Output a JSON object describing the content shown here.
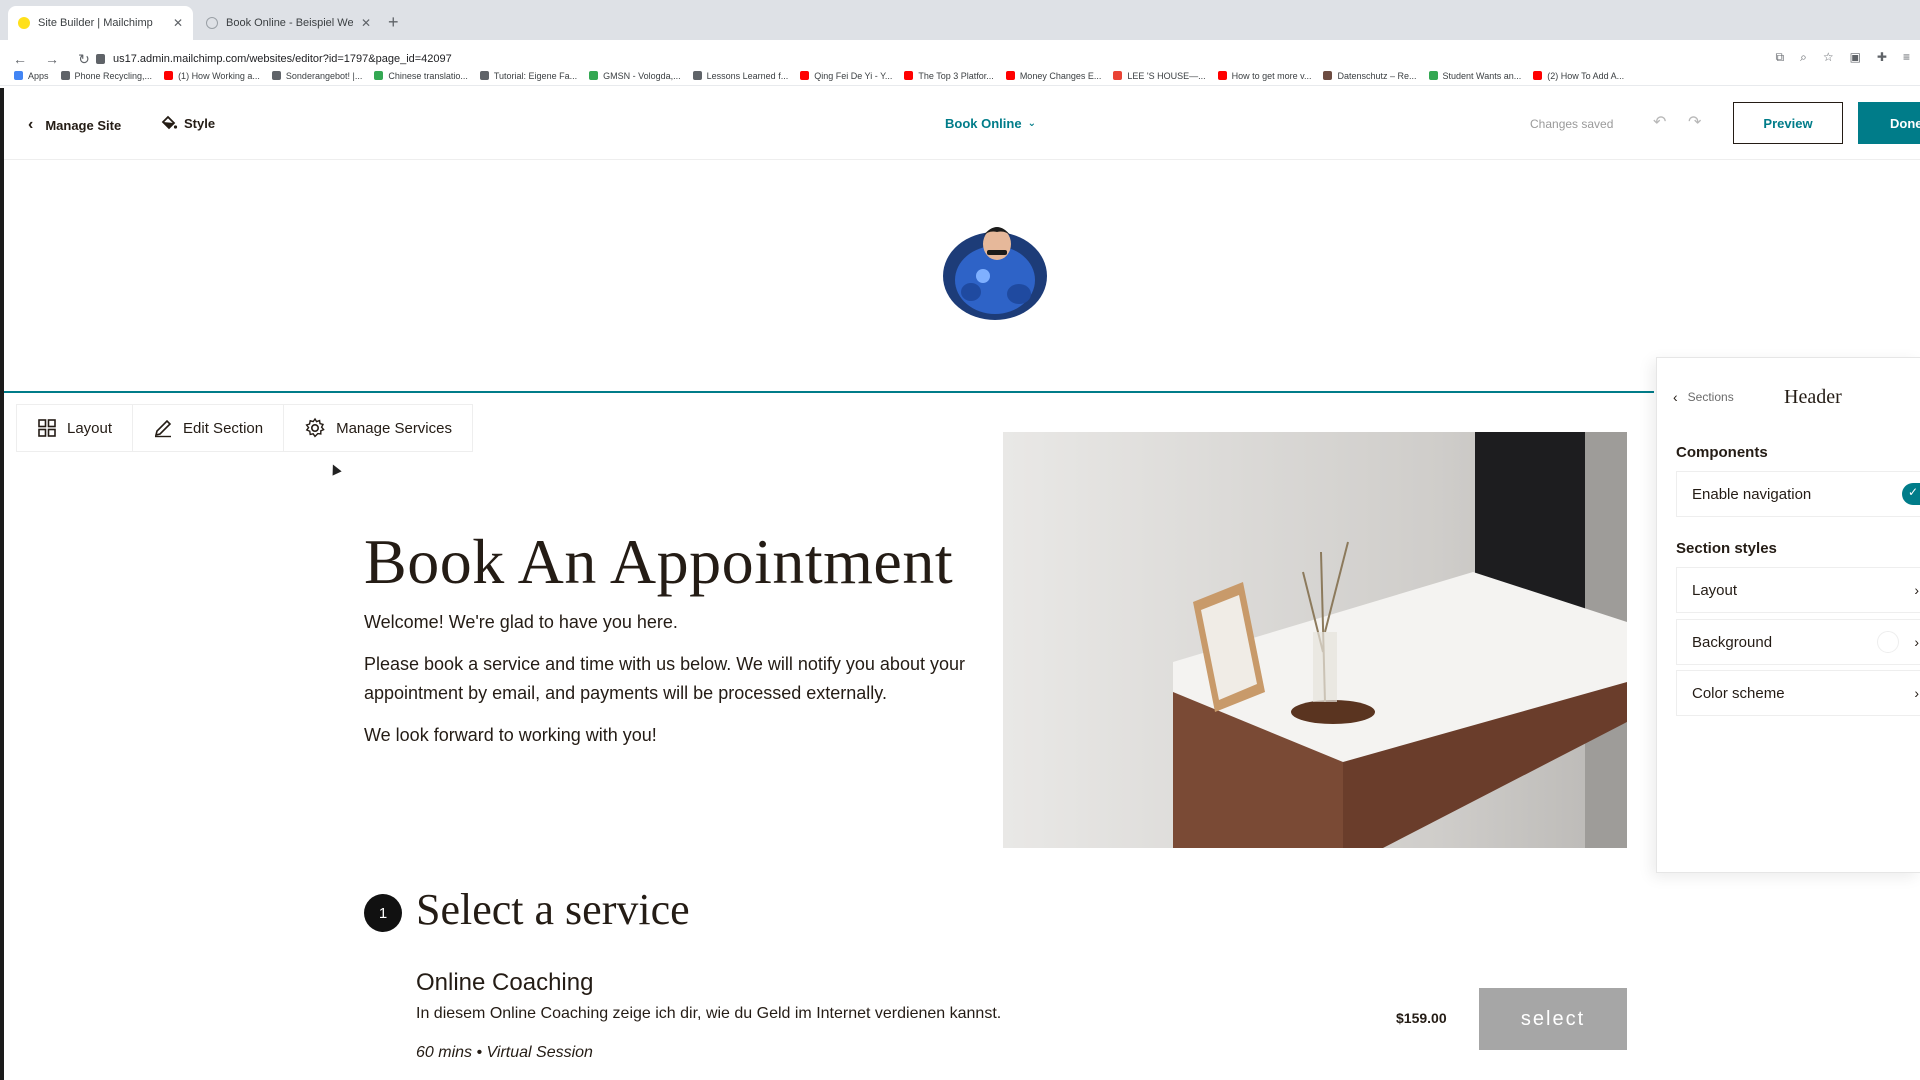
{
  "browser": {
    "tabs": [
      {
        "title": "Site Builder | Mailchimp",
        "favicon_color": "#ffe01b"
      },
      {
        "title": "Book Online - Beispiel Websei",
        "favicon_color": "#9aa0a6"
      }
    ],
    "url": "us17.admin.mailchimp.com/websites/editor?id=1797&page_id=42097",
    "bookmarks": [
      {
        "label": "Apps",
        "color": "#4285f4"
      },
      {
        "label": "Phone Recycling,...",
        "color": "#5f6368"
      },
      {
        "label": "(1) How Working a...",
        "color": "#ff0000"
      },
      {
        "label": "Sonderangebot! |...",
        "color": "#5f6368"
      },
      {
        "label": "Chinese translatio...",
        "color": "#34a853"
      },
      {
        "label": "Tutorial: Eigene Fa...",
        "color": "#5f6368"
      },
      {
        "label": "GMSN - Vologda,...",
        "color": "#34a853"
      },
      {
        "label": "Lessons Learned f...",
        "color": "#5f6368"
      },
      {
        "label": "Qing Fei De Yi - Y...",
        "color": "#ff0000"
      },
      {
        "label": "The Top 3 Platfor...",
        "color": "#ff0000"
      },
      {
        "label": "Money Changes E...",
        "color": "#ff0000"
      },
      {
        "label": "LEE 'S HOUSE—...",
        "color": "#ea4335"
      },
      {
        "label": "How to get more v...",
        "color": "#ff0000"
      },
      {
        "label": "Datenschutz – Re...",
        "color": "#6d4c41"
      },
      {
        "label": "Student Wants an...",
        "color": "#34a853"
      },
      {
        "label": "(2) How To Add A...",
        "color": "#ff0000"
      }
    ]
  },
  "appbar": {
    "manage_site": "Manage Site",
    "style": "Style",
    "page_name": "Book Online",
    "status": "Changes saved",
    "preview": "Preview",
    "done": "Done",
    "accent": "#007c89"
  },
  "toolbar": {
    "layout": "Layout",
    "edit_section": "Edit Section",
    "manage_services": "Manage Services"
  },
  "hero": {
    "title": "Book An Appointment",
    "p1": "Welcome! We're glad to have you here.",
    "p2": "Please book a service and time with us below. We will notify you about your appointment by email, and payments will be processed externally.",
    "p3": "We look forward to working with you!"
  },
  "services": {
    "step": "1",
    "heading": "Select a service",
    "items": [
      {
        "name": "Online Coaching",
        "description": "In diesem Online Coaching zeige ich dir, wie du Geld im Internet verdienen kannst.",
        "meta": "60 mins • Virtual Session",
        "price": "$159.00",
        "action": "select"
      }
    ]
  },
  "panel": {
    "back": "Sections",
    "title": "Header",
    "components_heading": "Components",
    "enable_navigation": "Enable navigation",
    "enable_navigation_on": true,
    "styles_heading": "Section styles",
    "layout": "Layout",
    "background": "Background",
    "color_scheme": "Color scheme"
  },
  "icons": [
    "chevron-left-icon",
    "paint-bucket-icon",
    "chevron-down-icon",
    "undo-icon",
    "redo-icon",
    "grid-icon",
    "pencil-icon",
    "gear-icon",
    "chevron-right-icon",
    "check-icon"
  ]
}
